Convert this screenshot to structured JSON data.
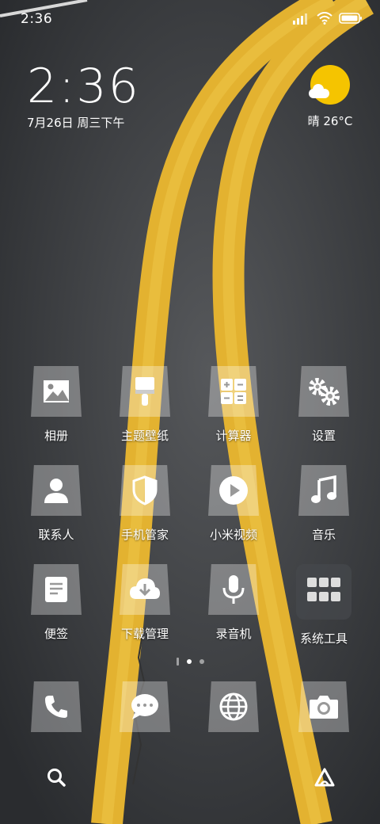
{
  "status": {
    "time": "2:36"
  },
  "clock": {
    "time": "2:36",
    "date": "7月26日 周三下午"
  },
  "weather": {
    "label": "晴 26°C",
    "icon": "sunny-weather-icon",
    "sun_color": "#f5c400"
  },
  "apps": [
    {
      "label": "相册",
      "icon": "gallery-icon"
    },
    {
      "label": "主题壁纸",
      "icon": "paint-brush-icon"
    },
    {
      "label": "计算器",
      "icon": "calculator-icon"
    },
    {
      "label": "设置",
      "icon": "gear-icon"
    },
    {
      "label": "联系人",
      "icon": "person-icon"
    },
    {
      "label": "手机管家",
      "icon": "shield-icon"
    },
    {
      "label": "小米视频",
      "icon": "play-icon"
    },
    {
      "label": "音乐",
      "icon": "music-note-icon"
    },
    {
      "label": "便签",
      "icon": "note-icon"
    },
    {
      "label": "下载管理",
      "icon": "cloud-download-icon"
    },
    {
      "label": "录音机",
      "icon": "microphone-icon"
    },
    {
      "label": "系统工具",
      "icon": "folder-icon"
    }
  ],
  "dock": [
    {
      "icon": "phone-icon"
    },
    {
      "icon": "message-bubble-icon"
    },
    {
      "icon": "globe-icon"
    },
    {
      "icon": "camera-icon"
    }
  ],
  "bottom_actions": [
    {
      "icon": "search-icon"
    },
    {
      "icon": "assistant-icon"
    }
  ],
  "pages": {
    "count": 3,
    "active": 2
  },
  "colors": {
    "road_line": "#e3b230",
    "asphalt": "#3f4144"
  }
}
